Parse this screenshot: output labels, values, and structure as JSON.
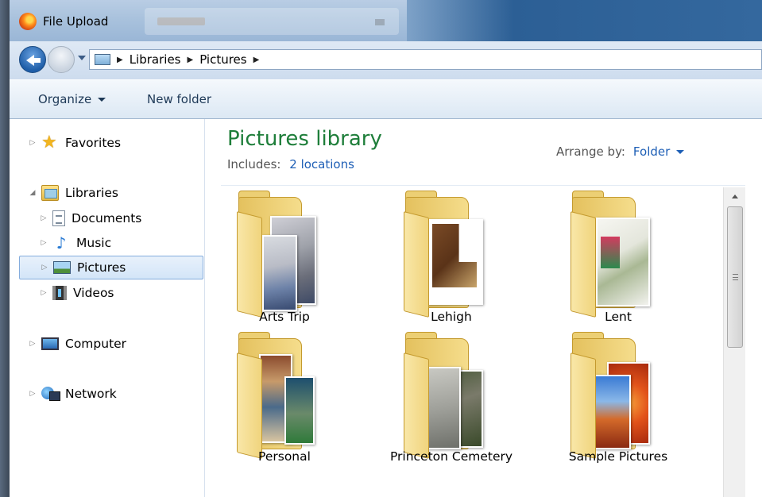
{
  "window": {
    "title": "File Upload"
  },
  "address": {
    "crumbs": [
      "Libraries",
      "Pictures"
    ]
  },
  "toolbar": {
    "organize_label": "Organize",
    "new_folder_label": "New folder"
  },
  "sidebar": {
    "favorites": "Favorites",
    "libraries": "Libraries",
    "documents": "Documents",
    "music": "Music",
    "pictures": "Pictures",
    "videos": "Videos",
    "computer": "Computer",
    "network": "Network",
    "selected": "Pictures"
  },
  "library": {
    "title": "Pictures library",
    "includes_label": "Includes:",
    "includes_link": "2 locations",
    "arrange_label": "Arrange by:",
    "arrange_value": "Folder"
  },
  "folders": [
    {
      "name": "Arts Trip"
    },
    {
      "name": "Lehigh"
    },
    {
      "name": "Lent"
    },
    {
      "name": "Personal"
    },
    {
      "name": "Princeton Cemetery"
    },
    {
      "name": "Sample Pictures"
    }
  ],
  "colors": {
    "library_title": "#1e7e3a",
    "link": "#1e5fb6",
    "selection_border": "#84acdd"
  }
}
